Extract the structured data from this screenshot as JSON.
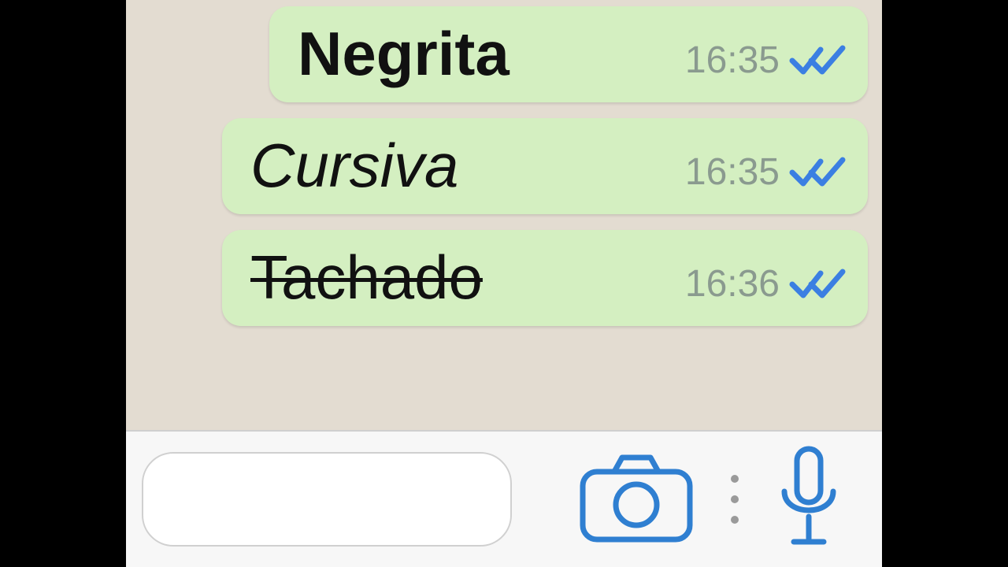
{
  "colors": {
    "bubble": "#d4efc1",
    "tick": "#3b7fe2",
    "icon": "#2f7fd1",
    "time": "#8a9a8f"
  },
  "messages": [
    {
      "text": "Negrita",
      "time": "16:35",
      "style": "bold",
      "read": true
    },
    {
      "text": "Cursiva",
      "time": "16:35",
      "style": "italic",
      "read": true
    },
    {
      "text": "Tachado",
      "time": "16:36",
      "style": "strike",
      "read": true
    }
  ],
  "input": {
    "placeholder": ""
  },
  "icons": {
    "camera": "camera-icon",
    "more": "more-vertical-icon",
    "mic": "microphone-icon",
    "ticks": "double-check-icon"
  }
}
